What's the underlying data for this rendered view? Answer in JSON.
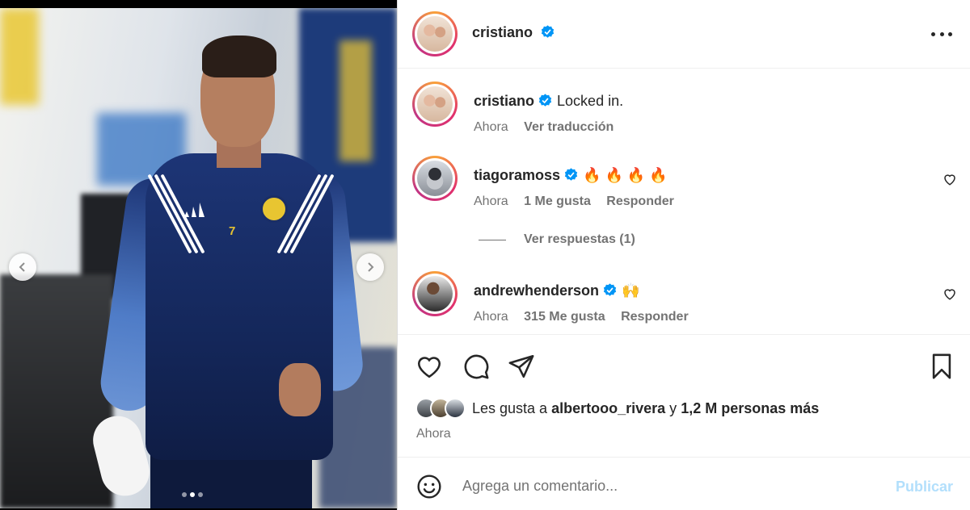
{
  "header": {
    "username": "cristiano",
    "verified_icon": "verified-badge-icon",
    "more_icon": "more-options-icon"
  },
  "caption": {
    "username": "cristiano",
    "text": "Locked in.",
    "time": "Ahora",
    "translate": "Ver traducción"
  },
  "comments": [
    {
      "username": "tiagoramoss",
      "text": "🔥 🔥 🔥 🔥",
      "time": "Ahora",
      "likes": "1 Me gusta",
      "reply": "Responder",
      "view_replies": "Ver respuestas (1)"
    },
    {
      "username": "andrewhenderson",
      "text": "🙌",
      "time": "Ahora",
      "likes": "315 Me gusta",
      "reply": "Responder"
    }
  ],
  "actions": {
    "like_icon": "heart-icon",
    "comment_icon": "comment-icon",
    "share_icon": "send-icon",
    "save_icon": "bookmark-icon"
  },
  "likes": {
    "prefix": "Les gusta a",
    "user": "albertooo_rivera",
    "connector": "y",
    "others": "1,2 M personas más"
  },
  "post_time": "Ahora",
  "composer": {
    "placeholder": "Agrega un comentario...",
    "post_label": "Publicar"
  },
  "carousel": {
    "total_slides": 3,
    "current_slide": 2
  },
  "colors": {
    "verified_blue": "#0095f6",
    "publish_disabled": "#b2dffc",
    "secondary_text": "#737373"
  }
}
